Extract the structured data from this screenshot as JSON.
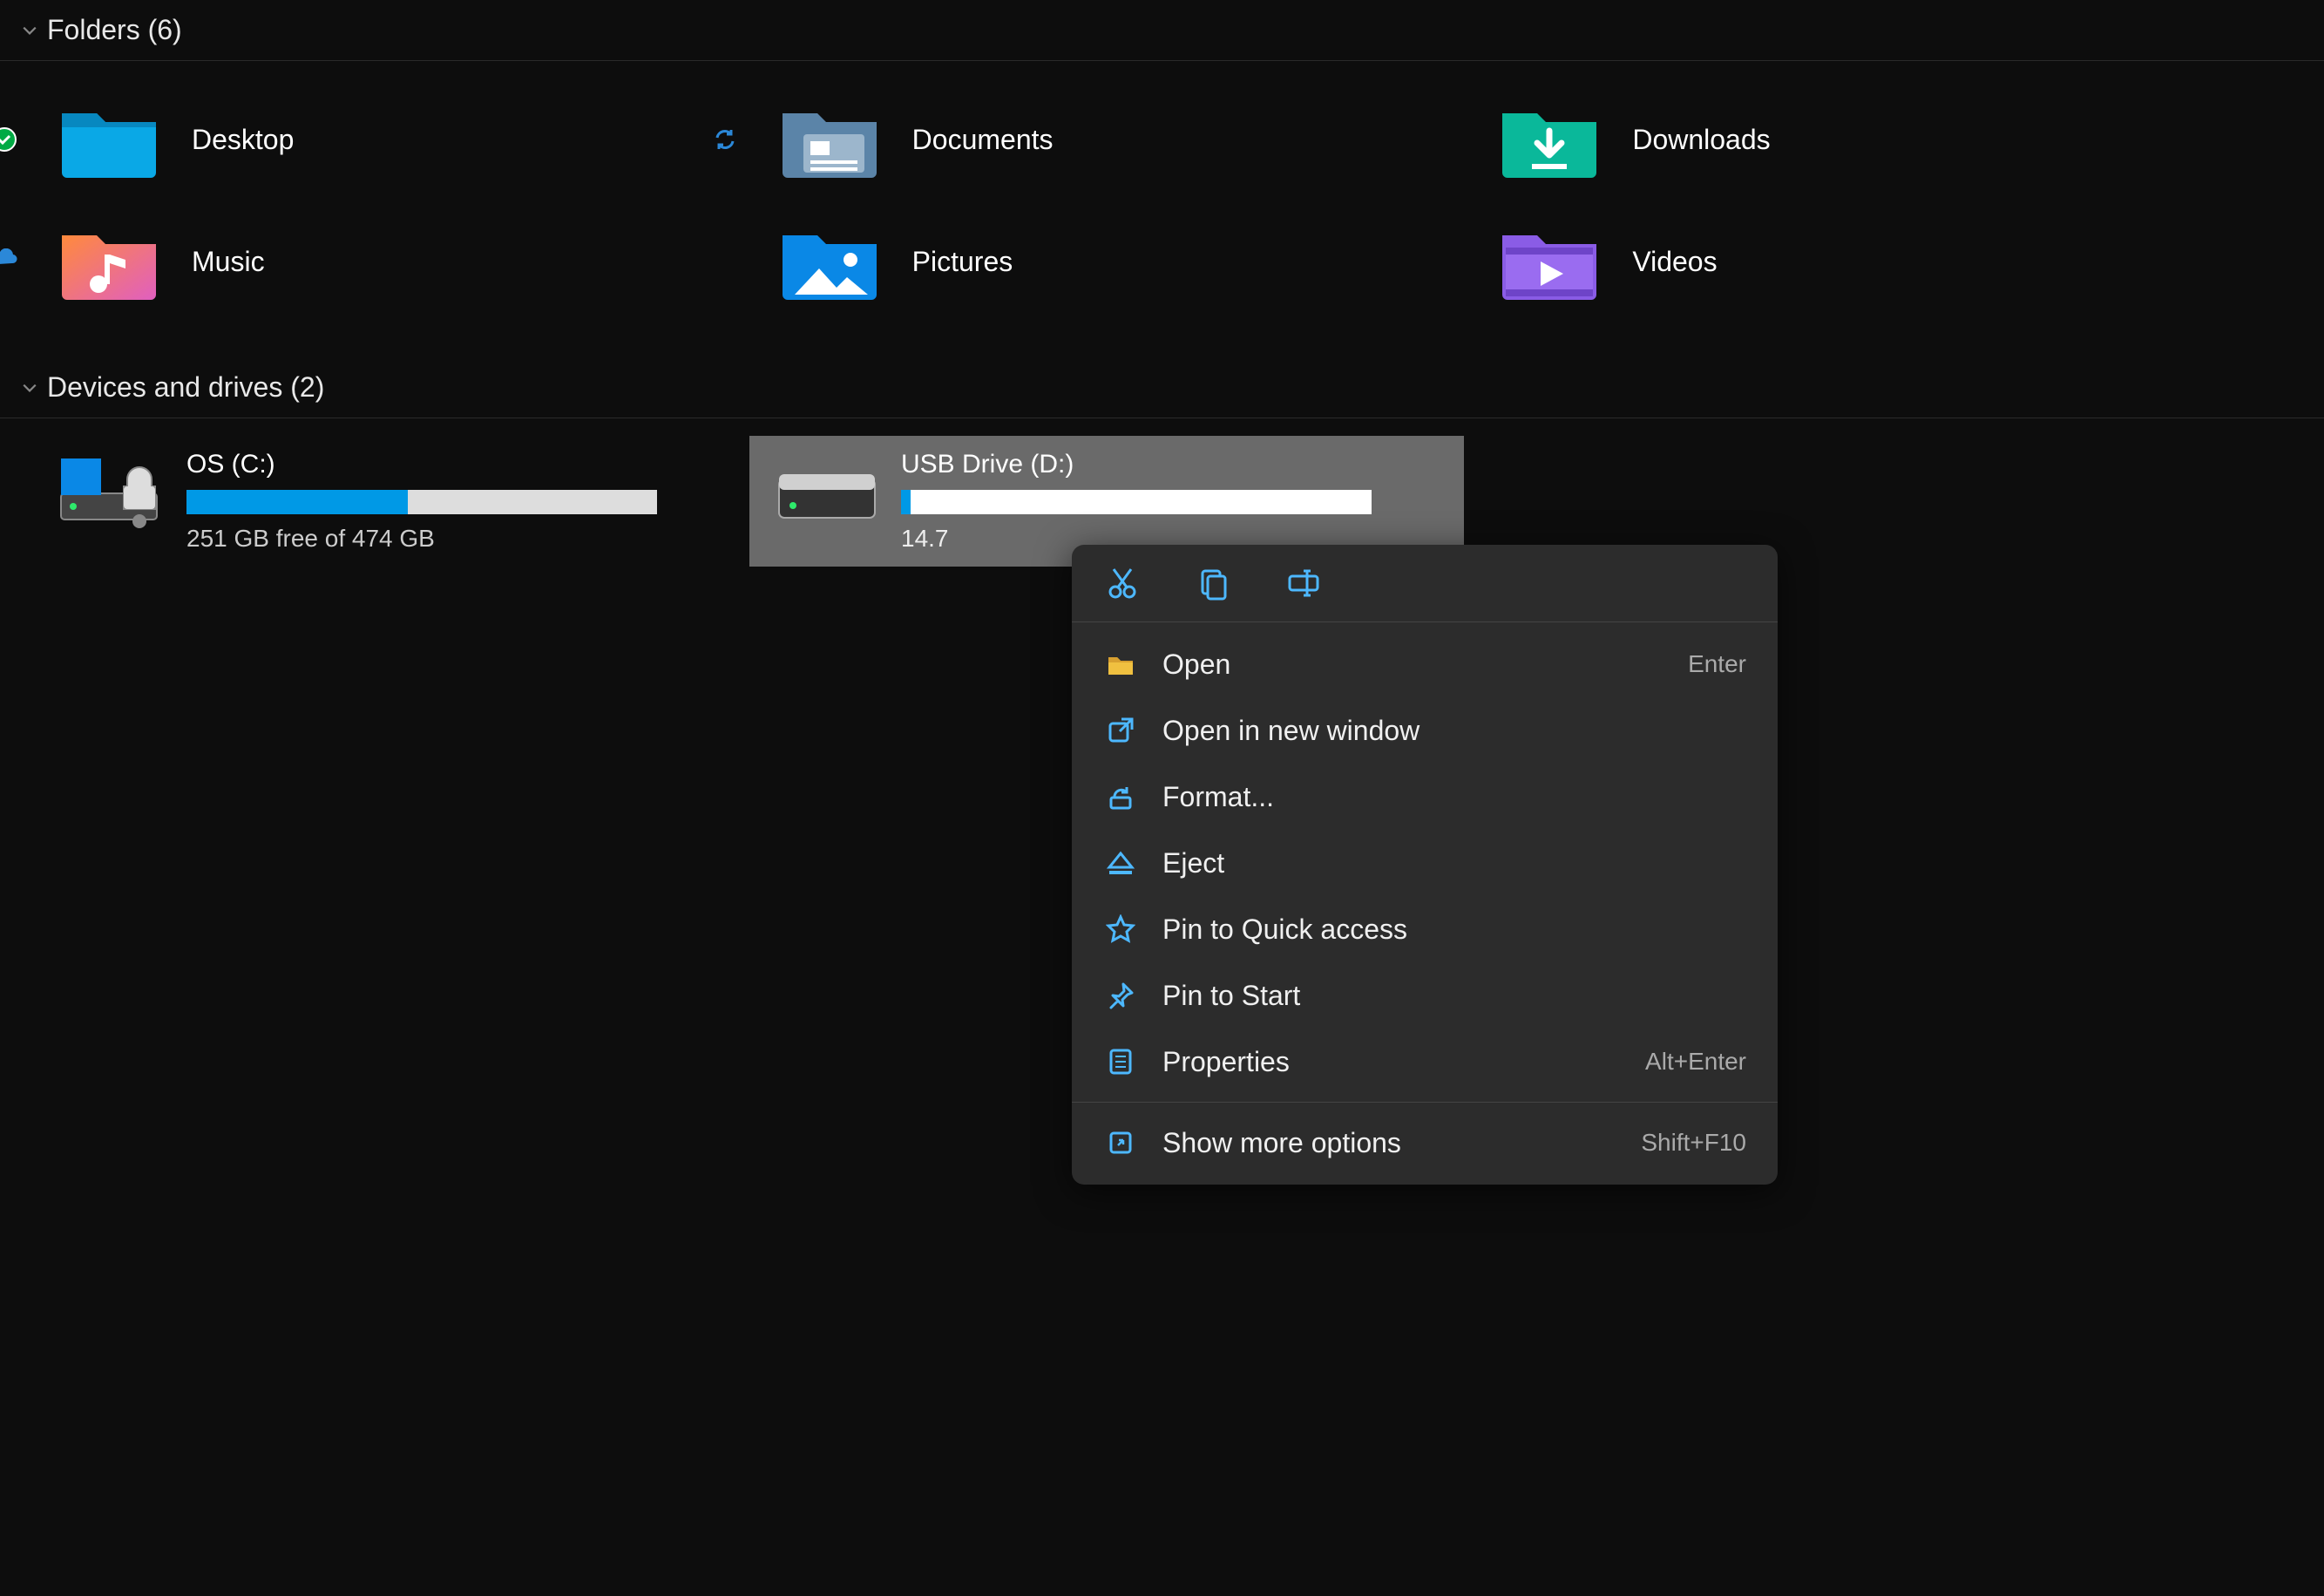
{
  "sections": {
    "folders": {
      "title": "Folders (6)"
    },
    "drives": {
      "title": "Devices and drives (2)"
    }
  },
  "folders": [
    {
      "label": "Desktop",
      "icon": "desktop-folder",
      "status": "synced"
    },
    {
      "label": "Documents",
      "icon": "documents-folder",
      "status": "sync"
    },
    {
      "label": "Downloads",
      "icon": "downloads-folder"
    },
    {
      "label": "Music",
      "icon": "music-folder",
      "status": "cloud"
    },
    {
      "label": "Pictures",
      "icon": "pictures-folder"
    },
    {
      "label": "Videos",
      "icon": "videos-folder"
    }
  ],
  "drives": [
    {
      "label": "OS (C:)",
      "sub": "251 GB free of 474 GB",
      "fill_pct": 47,
      "icon": "os-drive"
    },
    {
      "label": "USB Drive (D:)",
      "sub": "14.7",
      "fill_pct": 2,
      "icon": "usb-drive",
      "selected": true
    }
  ],
  "context_menu": {
    "toolbar": [
      {
        "name": "cut-icon"
      },
      {
        "name": "copy-icon"
      },
      {
        "name": "rename-icon"
      }
    ],
    "items": [
      {
        "icon": "folder-open-icon",
        "label": "Open",
        "shortcut": "Enter"
      },
      {
        "icon": "external-icon",
        "label": "Open in new window"
      },
      {
        "icon": "format-icon",
        "label": "Format..."
      },
      {
        "icon": "eject-icon",
        "label": "Eject"
      },
      {
        "icon": "star-icon",
        "label": "Pin to Quick access"
      },
      {
        "icon": "pin-icon",
        "label": "Pin to Start"
      },
      {
        "icon": "properties-icon",
        "label": "Properties",
        "shortcut": "Alt+Enter"
      },
      {
        "divider": true
      },
      {
        "icon": "more-icon",
        "label": "Show more options",
        "shortcut": "Shift+F10"
      }
    ]
  }
}
